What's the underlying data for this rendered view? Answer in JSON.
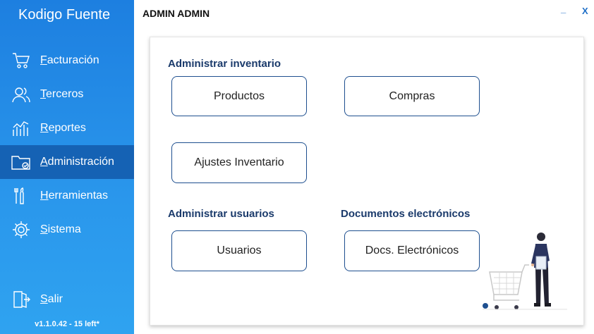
{
  "app": {
    "title": "Kodigo Fuente",
    "version": "v1.1.0.42 - 15 left*"
  },
  "sidebar": {
    "items": [
      {
        "label": "Facturación",
        "icon": "cart-icon",
        "active": false
      },
      {
        "label": "Terceros",
        "icon": "users-icon",
        "active": false
      },
      {
        "label": "Reportes",
        "icon": "chart-icon",
        "active": false
      },
      {
        "label": "Administración",
        "icon": "folder-settings-icon",
        "active": true
      },
      {
        "label": "Herramientas",
        "icon": "tools-icon",
        "active": false
      },
      {
        "label": "Sistema",
        "icon": "gear-icon",
        "active": false
      }
    ],
    "exit_label": "Salir"
  },
  "header": {
    "user": "ADMIN ADMIN",
    "minimize": "_",
    "close": "X"
  },
  "sections": {
    "inventario": "Administrar inventario",
    "usuarios": "Administrar usuarios",
    "documentos": "Documentos electrónicos"
  },
  "buttons": {
    "productos": "Productos",
    "compras": "Compras",
    "ajustes": "Ajustes Inventario",
    "usuarios": "Usuarios",
    "docs": "Docs. Electrónicos"
  },
  "colors": {
    "sidebar": "#1d7fe0",
    "active": "#1562b4",
    "accent": "#1e4f8f"
  }
}
